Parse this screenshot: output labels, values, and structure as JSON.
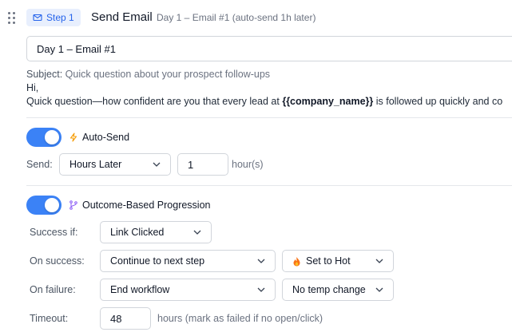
{
  "step": {
    "badge_label": "Step 1",
    "title": "Send Email",
    "subtitle": "Day 1 – Email #1 (auto-send 1h later)"
  },
  "email": {
    "name_value": "Day 1 – Email #1",
    "subject_label": "Subject:",
    "subject_value": "Quick question about your prospect follow-ups",
    "body_line1": "Hi,",
    "body_line2_prefix": "Quick question—how confident are you that every lead at ",
    "body_line2_variable": "{{company_name}}",
    "body_line2_suffix": " is followed up quickly and co"
  },
  "auto_send": {
    "enabled": true,
    "label": "Auto-Send",
    "icon": "lightning-icon",
    "send_label": "Send:",
    "send_mode": "Hours Later",
    "delay_value": "1",
    "delay_unit": "hour(s)"
  },
  "progression": {
    "enabled": true,
    "label": "Outcome-Based Progression",
    "icon": "branch-icon",
    "success_if_label": "Success if:",
    "success_if_value": "Link Clicked",
    "on_success_label": "On success:",
    "on_success_value": "Continue to next step",
    "on_success_temp": "Set to Hot",
    "on_success_temp_icon": "fire-icon",
    "on_failure_label": "On failure:",
    "on_failure_value": "End workflow",
    "on_failure_temp": "No temp change",
    "timeout_label": "Timeout:",
    "timeout_value": "48",
    "timeout_unit": "hours (mark as failed if no open/click)"
  },
  "colors": {
    "accent": "#3b82f6",
    "badge_bg": "#e8effd",
    "lightning": "#f59e0b",
    "branch": "#8b5cf6"
  }
}
